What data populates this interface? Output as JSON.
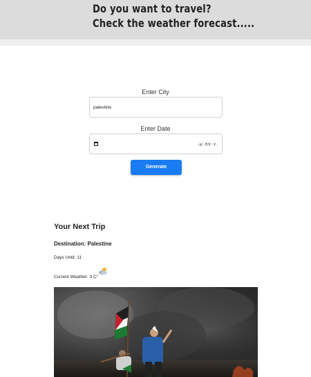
{
  "header": {
    "line1": "Do you want to travel?",
    "line2": "Check the weather forecast....."
  },
  "form": {
    "city_label": "Enter City",
    "city_value": "palestine",
    "date_label": "Enter Date",
    "date_value": "٠٨/٠٣/٢٠٢٠",
    "generate_label": "Generate"
  },
  "trip": {
    "title": "Your Next Trip",
    "destination": "Destination: Palestine",
    "days_label": "Days Until:",
    "days_value": "11",
    "weather_label": "Current Weather: 3 C°",
    "weather_icon": "partly-cloudy-icon"
  },
  "colors": {
    "header_bg": "#dcdcdc",
    "button_bg": "#1a7cf2"
  }
}
